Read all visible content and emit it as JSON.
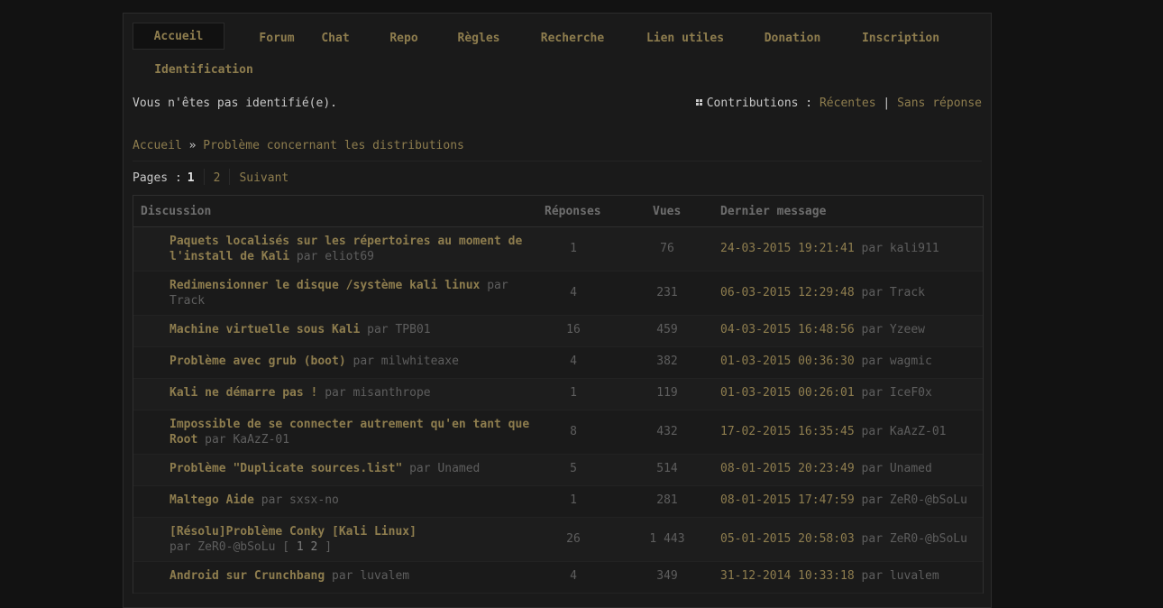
{
  "nav": {
    "tabs": [
      {
        "label": "Accueil",
        "active": true
      },
      {
        "label": "Forum"
      },
      {
        "label": "Chat"
      },
      {
        "label": "Repo"
      },
      {
        "label": "Règles"
      },
      {
        "label": "Recherche"
      },
      {
        "label": "Lien utiles"
      },
      {
        "label": "Donation"
      },
      {
        "label": "Inscription"
      },
      {
        "label": "Identification"
      }
    ]
  },
  "status": {
    "not_logged": "Vous n'êtes pas identifié(e).",
    "contributions_label": "Contributions :",
    "recent": "Récentes",
    "separator": "|",
    "no_reply": "Sans réponse"
  },
  "breadcrumb": {
    "home": "Accueil",
    "sep": "»",
    "current": "Problème concernant les distributions"
  },
  "pagination": {
    "label": "Pages :",
    "current": "1",
    "page2": "2",
    "next": "Suivant"
  },
  "table": {
    "headers": {
      "discussion": "Discussion",
      "replies": "Réponses",
      "views": "Vues",
      "last": "Dernier message"
    },
    "rows": [
      {
        "title": "Paquets localisés sur les répertoires au moment de l'install de Kali",
        "by": "par eliot69",
        "replies": "1",
        "views": "76",
        "date": "24-03-2015 19:21:41",
        "last_by": "par kali911"
      },
      {
        "title": "Redimensionner le disque /système kali linux",
        "by": "par Track",
        "replies": "4",
        "views": "231",
        "date": "06-03-2015 12:29:48",
        "last_by": "par Track"
      },
      {
        "title": "Machine virtuelle sous Kali",
        "by": "par TPB01",
        "replies": "16",
        "views": "459",
        "date": "04-03-2015 16:48:56",
        "last_by": "par Yzeew"
      },
      {
        "title": "Problème avec grub (boot)",
        "by": "par milwhiteaxe",
        "replies": "4",
        "views": "382",
        "date": "01-03-2015 00:36:30",
        "last_by": "par wagmic"
      },
      {
        "title": "Kali ne démarre pas !",
        "by": "par misanthrope",
        "replies": "1",
        "views": "119",
        "date": "01-03-2015 00:26:01",
        "last_by": "par IceF0x"
      },
      {
        "title": "Impossible de se connecter autrement qu'en tant que Root",
        "by": "par KaAzZ-01",
        "replies": "8",
        "views": "432",
        "date": "17-02-2015 16:35:45",
        "last_by": "par KaAzZ-01"
      },
      {
        "title": "Problème \"Duplicate sources.list\"",
        "by": "par Unamed",
        "replies": "5",
        "views": "514",
        "date": "08-01-2015 20:23:49",
        "last_by": "par Unamed"
      },
      {
        "title": "Maltego Aide",
        "by": "par sxsx-no",
        "replies": "1",
        "views": "281",
        "date": "08-01-2015 17:47:59",
        "last_by": "par ZeR0-@bSoLu"
      },
      {
        "title": "[Résolu]Problème Conky [Kali Linux]",
        "by": "par ZeR0-@bSoLu",
        "pages_open": "[",
        "pages": [
          "1",
          "2"
        ],
        "pages_close": "]",
        "replies": "26",
        "views": "1 443",
        "date": "05-01-2015 20:58:03",
        "last_by": "par ZeR0-@bSoLu"
      },
      {
        "title": "Android sur Crunchbang",
        "by": "par luvalem",
        "replies": "4",
        "views": "349",
        "date": "31-12-2014 10:33:18",
        "last_by": "par luvalem"
      }
    ]
  }
}
